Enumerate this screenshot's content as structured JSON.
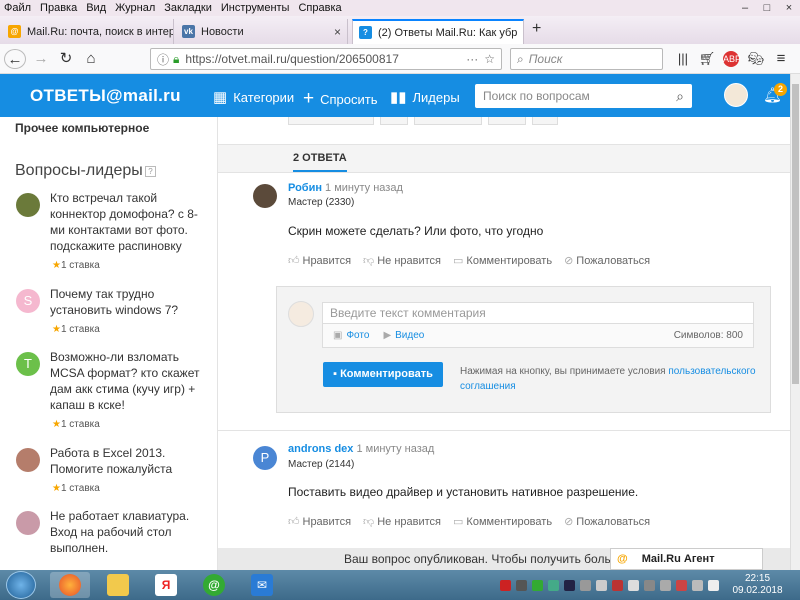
{
  "browser": {
    "menu": [
      "Файл",
      "Правка",
      "Вид",
      "Журнал",
      "Закладки",
      "Инструменты",
      "Справка"
    ],
    "tabs": [
      {
        "title": "Mail.Ru: почта, поиск в интер",
        "close": "×"
      },
      {
        "title": "Новости",
        "close": "×"
      },
      {
        "title": "(2) Ответы Mail.Ru: Как убр",
        "close": "×"
      }
    ],
    "new_tab": "+",
    "url": "https://otvet.mail.ru/question/206500817",
    "search_placeholder": "Поиск",
    "window_controls": [
      "–",
      "□",
      "×"
    ]
  },
  "site": {
    "logo": "ОТВЕТЫ@mail.ru",
    "nav": [
      {
        "label": "Категории",
        "icon": "grid-icon"
      },
      {
        "label": "Спросить",
        "icon": "plus-icon"
      },
      {
        "label": "Лидеры",
        "icon": "bar-chart-icon"
      }
    ],
    "search_placeholder": "Поиск по вопросам",
    "notif_count": "2"
  },
  "sidebar": {
    "category": "Прочее компьютерное",
    "leaders_title": "Вопросы-лидеры",
    "leaders_help": "?",
    "questions": [
      {
        "text": "Кто встречал такой коннектор домофона? с 8-ми контактами вот фото. подскажите распиновку",
        "bid": "1 ставка",
        "avatar": "",
        "color": "#6b7a3a"
      },
      {
        "text": "Почему так трудно установить windows 7?",
        "bid": "1 ставка",
        "avatar": "S",
        "color": "#f5b8cf"
      },
      {
        "text": "Возможно-ли взломать MCSA формат? кто скажет дам акк стима (кучу игр) + капаш в кске!",
        "bid": "1 ставка",
        "avatar": "T",
        "color": "#6cc04a"
      },
      {
        "text": "Работа в Excel 2013. Помогите пожалуйста",
        "bid": "1 ставка",
        "avatar": "",
        "color": "#b57d6b"
      },
      {
        "text": "Не работает клавиатура. Вход на рабочий стол выполнен.",
        "bid": "",
        "avatar": "",
        "color": "#c99aa8"
      }
    ]
  },
  "main": {
    "answers_title": "2 ОТВЕТА",
    "answers": [
      {
        "name": "Робин",
        "time": "1 минуту назад",
        "rank": "Мастер (2330)",
        "text": "Скрин можете сделать? Или фото, что угодно",
        "avatar": "",
        "color": "#5b4a3a"
      },
      {
        "name": "androns dex",
        "time": "1 минуту назад",
        "rank": "Мастер (2144)",
        "text": "Поставить видео драйвер и установить нативное разрешение.",
        "avatar": "P",
        "color": "#4a86d4"
      }
    ],
    "actions": {
      "like": "Нравится",
      "dislike": "Не нравится",
      "comment": "Комментировать",
      "report": "Пожаловаться"
    },
    "comment_form": {
      "placeholder": "Введите текст комментария",
      "photo": "Фото",
      "video": "Видео",
      "chars": "Символов: 800",
      "submit": "Комментировать",
      "terms_text": "Нажимая на кнопку, вы принимаете условия ",
      "terms_link": "пользовательского соглашения"
    },
    "published_bar": "Ваш вопрос опубликован. Чтобы получить больше"
  },
  "agent": "Mail.Ru Агент",
  "taskbar": {
    "time": "22:15",
    "date": "09.02.2018"
  }
}
